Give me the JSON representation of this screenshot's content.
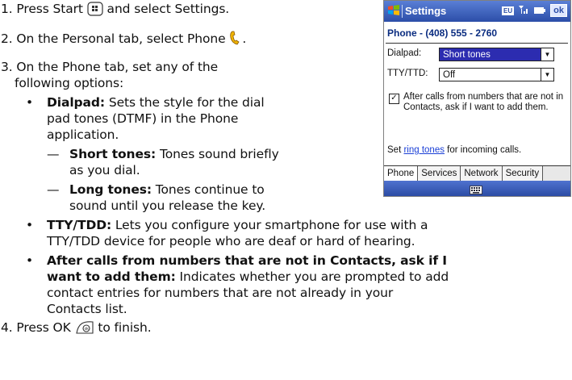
{
  "steps": [
    {
      "prefix": "1. Press Start ",
      "icon": "start-icon",
      "suffix": " and select Settings."
    },
    {
      "prefix": "2. On the Personal tab, select Phone ",
      "icon": "phone-handset-icon",
      "suffix": "."
    },
    {
      "line1": "3. On the Phone tab, set any of the",
      "line2": "following options:"
    },
    {
      "prefix": "4. Press OK ",
      "icon": "ok-button-icon",
      "suffix": " to finish."
    }
  ],
  "options": {
    "dialpad": {
      "term": "Dialpad:",
      "l1": " Sets the style for the dial",
      "l2": "pad tones (DTMF) in the Phone",
      "l3": "application.",
      "short_term": "Short tones:",
      "short_l1": " Tones sound briefly",
      "short_l2": "as you dial.",
      "long_term": "Long tones:",
      "long_l1": " Tones continue to",
      "long_l2": "sound until you release the key."
    },
    "tty": {
      "term": "TTY/TDD:",
      "l1": " Lets you configure your smartphone for use with a",
      "l2": "TTY/TDD device for people who are deaf or hard of hearing."
    },
    "after": {
      "term1": "After calls from numbers that are not in Contacts, ask if I",
      "term2": "want to add them:",
      "l2": " Indicates whether you are prompted to add",
      "l3": "contact entries for numbers that are not already in your",
      "l4": "Contacts list."
    }
  },
  "bullet": "•",
  "dash": "—",
  "phone": {
    "title": "Settings",
    "ok_label": "ok",
    "kbd_indicator": "EU",
    "subtitle": "Phone - (408) 555 - 2760",
    "dialpad_label": "Dialpad:",
    "dialpad_value": "Short tones",
    "tty_label": "TTY/TTD:",
    "tty_value": "Off",
    "checkbox_checked": true,
    "checkbox_text": "After calls from numbers that are not in Contacts, ask if I want to add them.",
    "ring_prefix": "Set ",
    "ring_link": "ring tones",
    "ring_suffix": " for incoming calls.",
    "tabs": [
      "Phone",
      "Services",
      "Network",
      "Security"
    ],
    "active_tab": "Phone"
  },
  "colors": {
    "titlebar": "#2c4ea8",
    "selection": "#2c2cb0",
    "link": "#1a3fd6"
  }
}
